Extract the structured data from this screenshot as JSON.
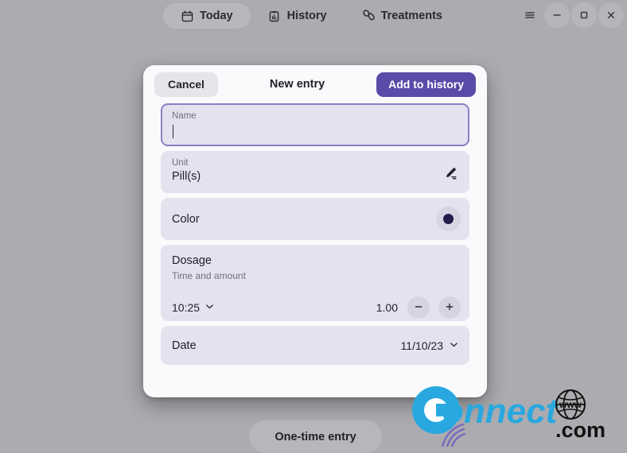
{
  "window": {
    "tabs": [
      {
        "label": "Today",
        "icon": "calendar-icon",
        "active": true
      },
      {
        "label": "History",
        "icon": "clipboard-chart-icon",
        "active": false
      },
      {
        "label": "Treatments",
        "icon": "pills-icon",
        "active": false
      }
    ],
    "controls": [
      {
        "name": "menu-button",
        "icon": "hamburger-icon"
      },
      {
        "name": "minimize-button",
        "icon": "minimize-icon"
      },
      {
        "name": "maximize-button",
        "icon": "maximize-icon"
      },
      {
        "name": "close-button",
        "icon": "close-icon"
      }
    ]
  },
  "dialog": {
    "title": "New entry",
    "cancel_label": "Cancel",
    "submit_label": "Add to history",
    "name": {
      "label": "Name",
      "value": "",
      "focused": true
    },
    "unit": {
      "label": "Unit",
      "value": "Pill(s)",
      "edit_icon": "pencil-icon"
    },
    "color": {
      "label": "Color",
      "swatch_hex": "#241c4a"
    },
    "dosage": {
      "title": "Dosage",
      "subtitle": "Time and amount",
      "time": "10:25",
      "time_chevron": "chevron-down-icon",
      "amount": "1.00",
      "decrement_label": "−",
      "increment_label": "+"
    },
    "date": {
      "label": "Date",
      "value": "11/10/23",
      "chevron": "chevron-down-icon"
    }
  },
  "footer": {
    "one_time_entry_label": "One-time entry"
  },
  "watermark": {
    "brand": "Connect",
    "suffix": ".com",
    "globe_text": "www",
    "brand_hex": "#29a8e0",
    "swoosh_hex": "#7a6fbd"
  },
  "colors": {
    "desktop_bg": "#acacb0",
    "dialog_bg": "#fafafc",
    "row_bg": "#e4e2ee",
    "accent": "#5a4ba8",
    "focus_border": "#8a7fc4"
  }
}
